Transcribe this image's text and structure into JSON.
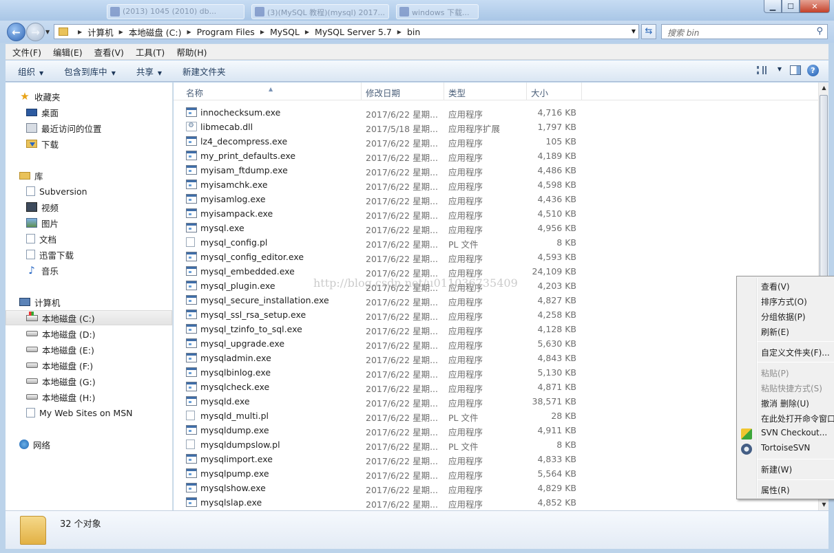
{
  "taskbar_ghost_tabs": [
    "(2013) 1045 (2010) db...",
    "(3)(MySQL 教程)(mysql) 2017...",
    "windows 下载..."
  ],
  "window_buttons": {
    "minimize": "▁",
    "maximize": "☐",
    "close": "✕"
  },
  "address": {
    "crumbs": [
      "计算机",
      "本地磁盘 (C:)",
      "Program Files",
      "MySQL",
      "MySQL Server 5.7",
      "bin"
    ],
    "search_placeholder": "搜索 bin"
  },
  "menubar": [
    "文件(F)",
    "编辑(E)",
    "查看(V)",
    "工具(T)",
    "帮助(H)"
  ],
  "toolbar": [
    "组织",
    "包含到库中",
    "共享",
    "新建文件夹"
  ],
  "nav": {
    "favorites": "收藏夹",
    "fav_items": [
      "桌面",
      "最近访问的位置",
      "下载"
    ],
    "libraries": "库",
    "lib_items": [
      "Subversion",
      "视频",
      "图片",
      "文档",
      "迅雷下载",
      "音乐"
    ],
    "computer": "计算机",
    "drives": [
      "本地磁盘 (C:)",
      "本地磁盘 (D:)",
      "本地磁盘 (E:)",
      "本地磁盘 (F:)",
      "本地磁盘 (G:)",
      "本地磁盘 (H:)"
    ],
    "msn": "My Web Sites on MSN",
    "network": "网络"
  },
  "columns": [
    "名称",
    "修改日期",
    "类型",
    "大小"
  ],
  "files": [
    {
      "name": "innochecksum.exe",
      "date": "2017/6/22 星期...",
      "type": "应用程序",
      "size": "4,716 KB",
      "icon": "exe"
    },
    {
      "name": "libmecab.dll",
      "date": "2017/5/18 星期...",
      "type": "应用程序扩展",
      "size": "1,797 KB",
      "icon": "dll"
    },
    {
      "name": "lz4_decompress.exe",
      "date": "2017/6/22 星期...",
      "type": "应用程序",
      "size": "105 KB",
      "icon": "exe"
    },
    {
      "name": "my_print_defaults.exe",
      "date": "2017/6/22 星期...",
      "type": "应用程序",
      "size": "4,189 KB",
      "icon": "exe"
    },
    {
      "name": "myisam_ftdump.exe",
      "date": "2017/6/22 星期...",
      "type": "应用程序",
      "size": "4,486 KB",
      "icon": "exe"
    },
    {
      "name": "myisamchk.exe",
      "date": "2017/6/22 星期...",
      "type": "应用程序",
      "size": "4,598 KB",
      "icon": "exe"
    },
    {
      "name": "myisamlog.exe",
      "date": "2017/6/22 星期...",
      "type": "应用程序",
      "size": "4,436 KB",
      "icon": "exe"
    },
    {
      "name": "myisampack.exe",
      "date": "2017/6/22 星期...",
      "type": "应用程序",
      "size": "4,510 KB",
      "icon": "exe"
    },
    {
      "name": "mysql.exe",
      "date": "2017/6/22 星期...",
      "type": "应用程序",
      "size": "4,956 KB",
      "icon": "exe"
    },
    {
      "name": "mysql_config.pl",
      "date": "2017/6/22 星期...",
      "type": "PL 文件",
      "size": "8 KB",
      "icon": "pl"
    },
    {
      "name": "mysql_config_editor.exe",
      "date": "2017/6/22 星期...",
      "type": "应用程序",
      "size": "4,593 KB",
      "icon": "exe"
    },
    {
      "name": "mysql_embedded.exe",
      "date": "2017/6/22 星期...",
      "type": "应用程序",
      "size": "24,109 KB",
      "icon": "exe"
    },
    {
      "name": "mysql_plugin.exe",
      "date": "2017/6/22 星期...",
      "type": "应用程序",
      "size": "4,203 KB",
      "icon": "exe"
    },
    {
      "name": "mysql_secure_installation.exe",
      "date": "2017/6/22 星期...",
      "type": "应用程序",
      "size": "4,827 KB",
      "icon": "exe"
    },
    {
      "name": "mysql_ssl_rsa_setup.exe",
      "date": "2017/6/22 星期...",
      "type": "应用程序",
      "size": "4,258 KB",
      "icon": "exe"
    },
    {
      "name": "mysql_tzinfo_to_sql.exe",
      "date": "2017/6/22 星期...",
      "type": "应用程序",
      "size": "4,128 KB",
      "icon": "exe"
    },
    {
      "name": "mysql_upgrade.exe",
      "date": "2017/6/22 星期...",
      "type": "应用程序",
      "size": "5,630 KB",
      "icon": "exe"
    },
    {
      "name": "mysqladmin.exe",
      "date": "2017/6/22 星期...",
      "type": "应用程序",
      "size": "4,843 KB",
      "icon": "exe"
    },
    {
      "name": "mysqlbinlog.exe",
      "date": "2017/6/22 星期...",
      "type": "应用程序",
      "size": "5,130 KB",
      "icon": "exe"
    },
    {
      "name": "mysqlcheck.exe",
      "date": "2017/6/22 星期...",
      "type": "应用程序",
      "size": "4,871 KB",
      "icon": "exe"
    },
    {
      "name": "mysqld.exe",
      "date": "2017/6/22 星期...",
      "type": "应用程序",
      "size": "38,571 KB",
      "icon": "exe"
    },
    {
      "name": "mysqld_multi.pl",
      "date": "2017/6/22 星期...",
      "type": "PL 文件",
      "size": "28 KB",
      "icon": "pl"
    },
    {
      "name": "mysqldump.exe",
      "date": "2017/6/22 星期...",
      "type": "应用程序",
      "size": "4,911 KB",
      "icon": "exe"
    },
    {
      "name": "mysqldumpslow.pl",
      "date": "2017/6/22 星期...",
      "type": "PL 文件",
      "size": "8 KB",
      "icon": "pl"
    },
    {
      "name": "mysqlimport.exe",
      "date": "2017/6/22 星期...",
      "type": "应用程序",
      "size": "4,833 KB",
      "icon": "exe"
    },
    {
      "name": "mysqlpump.exe",
      "date": "2017/6/22 星期...",
      "type": "应用程序",
      "size": "5,564 KB",
      "icon": "exe"
    },
    {
      "name": "mysqlshow.exe",
      "date": "2017/6/22 星期...",
      "type": "应用程序",
      "size": "4,829 KB",
      "icon": "exe"
    },
    {
      "name": "mysqlslap.exe",
      "date": "2017/6/22 星期...",
      "type": "应用程序",
      "size": "4,852 KB",
      "icon": "exe"
    }
  ],
  "watermark": "http://blog.csdn.net/u011036735409",
  "status": {
    "object_count": "32 个对象"
  },
  "context_menu": {
    "view": "查看(V)",
    "sort": "排序方式(O)",
    "group": "分组依据(P)",
    "refresh": "刷新(E)",
    "customize": "自定义文件夹(F)...",
    "paste": "粘贴(P)",
    "paste_shortcut": "粘贴快捷方式(S)",
    "undo_delete": "撤消 删除(U)",
    "open_cmd": "在此处打开命令窗口",
    "svn_checkout": "SVN Checkout...",
    "tortoise": "TortoiseSVN",
    "new": "新建(W)",
    "properties": "属性(R)"
  }
}
